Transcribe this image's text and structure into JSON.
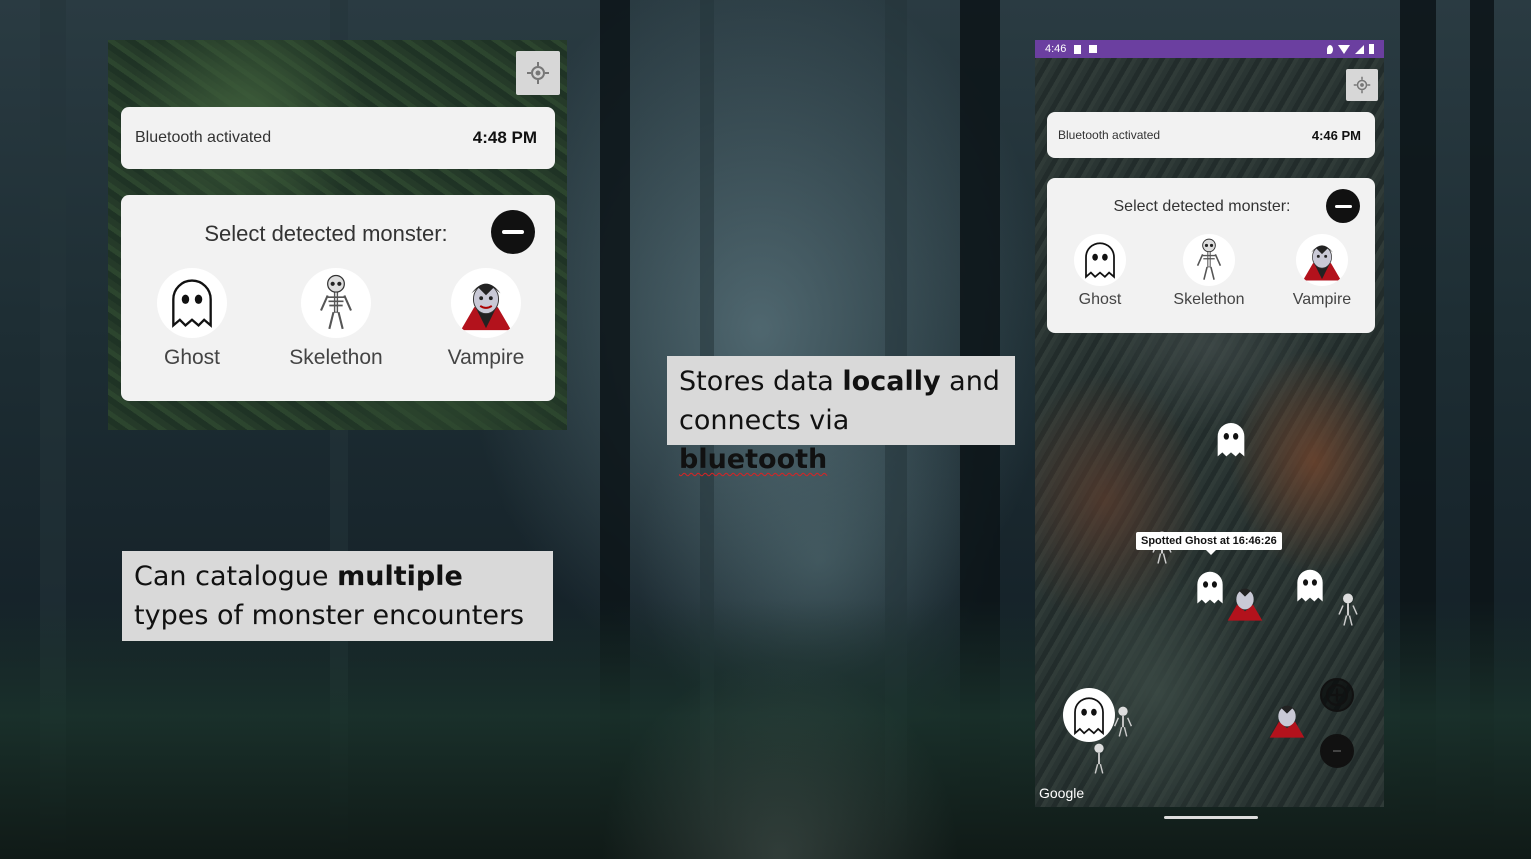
{
  "left_panel": {
    "status_text": "Bluetooth activated",
    "status_time": "4:48 PM",
    "select_title": "Select detected monster:",
    "monsters": [
      {
        "label": "Ghost",
        "icon": "ghost-icon"
      },
      {
        "label": "Skelethon",
        "icon": "skeleton-icon"
      },
      {
        "label": "Vampire",
        "icon": "vampire-icon"
      }
    ]
  },
  "callouts": {
    "storage": {
      "pre": "Stores data ",
      "bold1": "locally",
      "mid": " and connects via ",
      "bold2": "bluetooth"
    },
    "catalogue": {
      "pre": "Can catalogue ",
      "bold": "multiple",
      "post": " types of monster encounters"
    }
  },
  "phone": {
    "statusbar_time": "4:46",
    "status_text": "Bluetooth activated",
    "status_time": "4:46 PM",
    "select_title": "Select detected monster:",
    "monsters": [
      {
        "label": "Ghost",
        "icon": "ghost-icon"
      },
      {
        "label": "Skelethon",
        "icon": "skeleton-icon"
      },
      {
        "label": "Vampire",
        "icon": "vampire-icon"
      }
    ],
    "tooltip": "Spotted Ghost at 16:46:26",
    "map_attribution": "Google"
  },
  "colors": {
    "statusbar": "#6b3fa0",
    "card": "#f2f2f2",
    "vampire_cape": "#b3121c"
  }
}
